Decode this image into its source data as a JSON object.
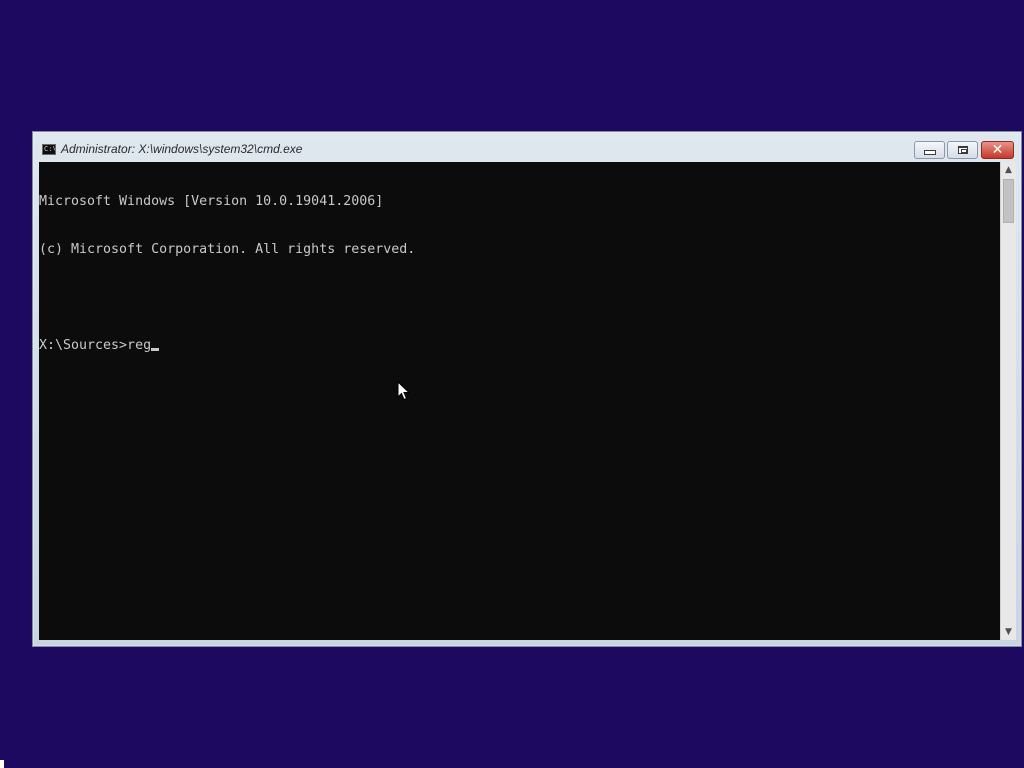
{
  "window": {
    "title": "Administrator: X:\\windows\\system32\\cmd.exe",
    "icon": "console-icon",
    "icon_text": "C:\\",
    "controls": {
      "minimize": "minimize-icon",
      "maximize": "maximize-icon",
      "close": "close-icon",
      "close_glyph": "✕"
    }
  },
  "console": {
    "lines": [
      "Microsoft Windows [Version 10.0.19041.2006]",
      "(c) Microsoft Corporation. All rights reserved.",
      "",
      "X:\\Sources>reg"
    ],
    "text_color": "#c8c8c8",
    "background_color": "#0c0c0c"
  },
  "scrollbar": {
    "up_glyph": "▲",
    "down_glyph": "▼"
  },
  "colors": {
    "desktop": "#1d0a60",
    "close_button": "#c4382a"
  }
}
